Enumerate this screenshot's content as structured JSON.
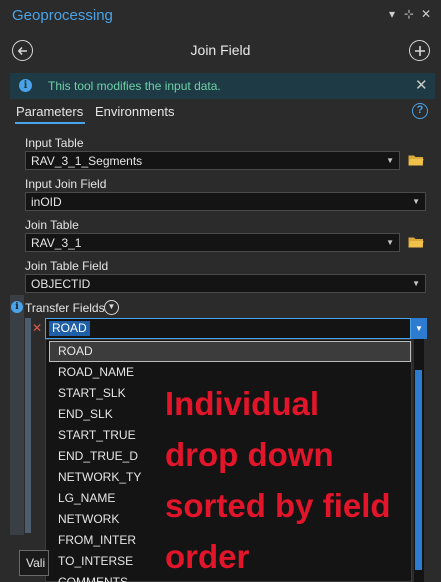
{
  "window": {
    "title": "Geoprocessing",
    "controls": [
      "▾",
      "⊹",
      "✕"
    ]
  },
  "tool": {
    "title": "Join Field",
    "back_icon": "arrow-left-circle-icon",
    "add_icon": "plus-circle-icon"
  },
  "info_banner": {
    "text": "This tool modifies the input data.",
    "icon": "info-icon",
    "close": "✕"
  },
  "tabs": [
    {
      "label": "Parameters",
      "active": true
    },
    {
      "label": "Environments",
      "active": false
    }
  ],
  "help": "?",
  "params": {
    "input_table": {
      "label": "Input Table",
      "value": "RAV_3_1_Segments"
    },
    "input_join_field": {
      "label": "Input Join Field",
      "value": "inOID"
    },
    "join_table": {
      "label": "Join Table",
      "value": "RAV_3_1"
    },
    "join_table_field": {
      "label": "Join Table Field",
      "value": "OBJECTID"
    },
    "transfer_fields": {
      "label": "Transfer Fields",
      "value": "ROAD"
    }
  },
  "dropdown": {
    "items": [
      "ROAD",
      "ROAD_NAME",
      "START_SLK",
      "END_SLK",
      "START_TRUE",
      "END_TRUE_D",
      "NETWORK_TY",
      "LG_NAME",
      "NETWORK",
      "FROM_INTER",
      "TO_INTERSE",
      "COMMENTS"
    ],
    "highlighted_index": 0
  },
  "annotation": {
    "lines": [
      "Individual",
      "drop down",
      "sorted by field",
      "order"
    ],
    "color": "#e3152a"
  },
  "validate_button": "Vali",
  "colors": {
    "accent": "#4aa3e8",
    "panel": "#2b2b2b",
    "field": "#141414",
    "info_text": "#6fd0a8"
  }
}
